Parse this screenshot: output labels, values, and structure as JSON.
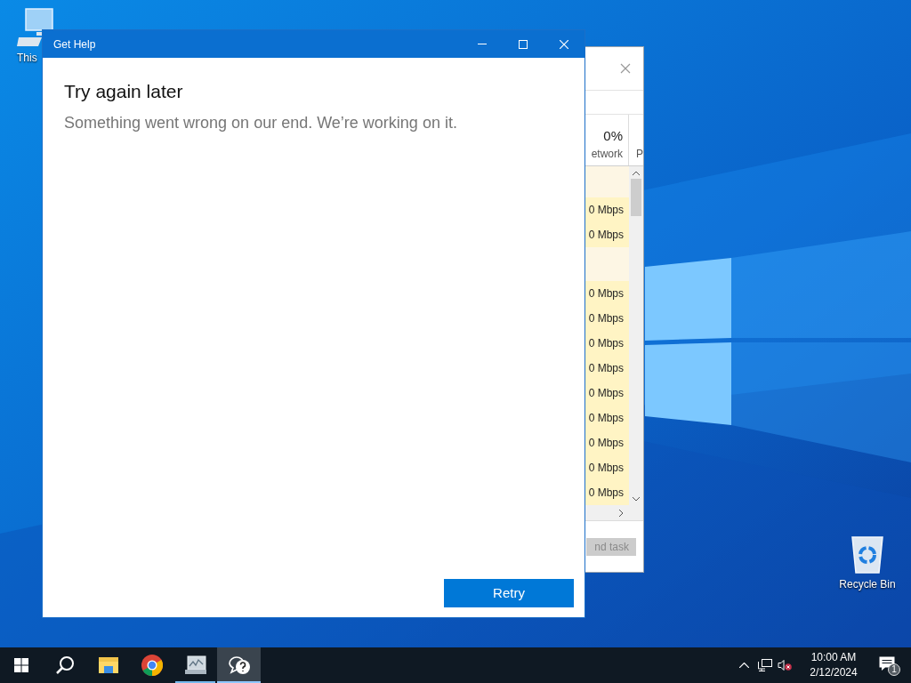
{
  "desktop_icons": [
    {
      "kind": "computer",
      "label": "This"
    },
    {
      "kind": "recycle-bin",
      "label": "Recycle Bin"
    }
  ],
  "task_manager": {
    "cpu_reading": "0%",
    "column": "etwork",
    "next_column": "P",
    "rows": [
      {
        "kind": "group"
      },
      {
        "kind": "process",
        "network": "0 Mbps"
      },
      {
        "kind": "process",
        "network": "0 Mbps"
      },
      {
        "kind": "group"
      },
      {
        "kind": "process",
        "network": "0 Mbps"
      },
      {
        "kind": "process",
        "network": "0 Mbps"
      },
      {
        "kind": "process",
        "network": "0 Mbps"
      },
      {
        "kind": "process",
        "network": "0 Mbps"
      },
      {
        "kind": "process",
        "network": "0 Mbps"
      },
      {
        "kind": "process",
        "network": "0 Mbps"
      },
      {
        "kind": "process",
        "network": "0 Mbps"
      },
      {
        "kind": "process",
        "network": "0 Mbps"
      },
      {
        "kind": "process",
        "network": "0 Mbps"
      }
    ],
    "end_task": {
      "label": "nd task",
      "disabled": true
    }
  },
  "get_help": {
    "title": "Get Help",
    "heading": "Try again later",
    "message": "Something went wrong on our end. We’re working on it.",
    "button": "Retry"
  },
  "taskbar": {
    "apps": [
      {
        "kind": "start",
        "running": false,
        "selected": false
      },
      {
        "kind": "search",
        "running": false,
        "selected": false
      },
      {
        "kind": "folder",
        "running": false,
        "selected": false
      },
      {
        "kind": "browser",
        "running": false,
        "selected": false
      },
      {
        "kind": "monitor",
        "running": true,
        "selected": false
      },
      {
        "kind": "help",
        "running": true,
        "selected": true
      }
    ],
    "time": "10:00 AM",
    "date": "2/12/2024",
    "notification_count": "1",
    "volume_muted": true
  }
}
